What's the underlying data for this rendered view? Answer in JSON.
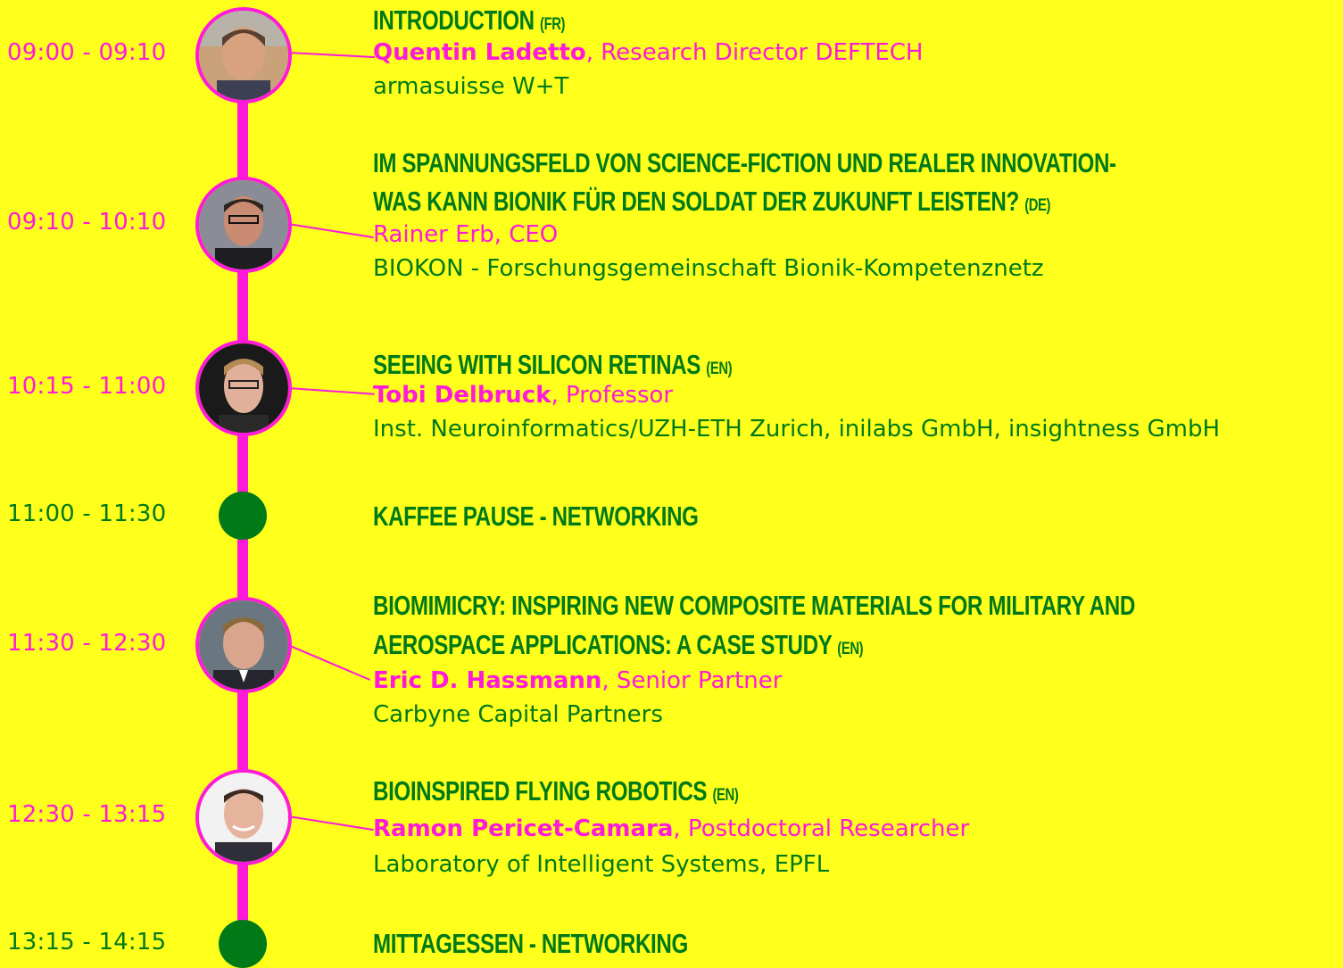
{
  "colors": {
    "background": "#ffff1c",
    "accent": "#ff1ad9",
    "green": "#007a17"
  },
  "sessions": [
    {
      "time": "09:00 - 09:10",
      "title": "INTRODUCTION",
      "lang": "(FR)",
      "speaker_name": "Quentin Ladetto",
      "speaker_role": ", Research Director DEFTECH",
      "org": "armasuisse W+T",
      "photo": "speaker-photo"
    },
    {
      "time": "09:10 - 10:10",
      "title_line1": "IM SPANNUNGSFELD VON SCIENCE-FICTION UND REALER INNOVATION-",
      "title_line2": "WAS KANN BIONIK FÜR DEN SOLDAT DER ZUKUNFT LEISTEN?",
      "lang": "(DE)",
      "speaker": "Rainer Erb, CEO",
      "org": "BIOKON - Forschungsgemeinschaft Bionik-Kompetenznetz",
      "photo": "speaker-photo"
    },
    {
      "time": "10:15 - 11:00",
      "title": "SEEING WITH SILICON RETINAS",
      "lang": "(EN)",
      "speaker_name": "Tobi Delbruck",
      "speaker_role": ", Professor",
      "org": "Inst. Neuroinformatics/UZH-ETH Zurich, inilabs GmbH, insightness GmbH",
      "photo": "speaker-photo"
    },
    {
      "time": "11:00 - 11:30",
      "title": "KAFFEE PAUSE - NETWORKING"
    },
    {
      "time": "11:30 - 12:30",
      "title_line1": "BIOMIMICRY: INSPIRING NEW COMPOSITE MATERIALS FOR MILITARY AND",
      "title_line2": "AEROSPACE APPLICATIONS: A CASE STUDY",
      "lang": "(EN)",
      "speaker_name": "Eric D. Hassmann",
      "speaker_role": ", Senior Partner",
      "org": "Carbyne Capital Partners",
      "photo": "speaker-photo"
    },
    {
      "time": "12:30 - 13:15",
      "title": "BIOINSPIRED FLYING ROBOTICS",
      "lang": "(EN)",
      "speaker_name": "Ramon Pericet-Camara",
      "speaker_role": ", Postdoctoral Researcher",
      "org": "Laboratory of Intelligent Systems, EPFL",
      "photo": "speaker-photo"
    },
    {
      "time": "13:15 - 14:15",
      "title": "MITTAGESSEN - NETWORKING"
    }
  ]
}
